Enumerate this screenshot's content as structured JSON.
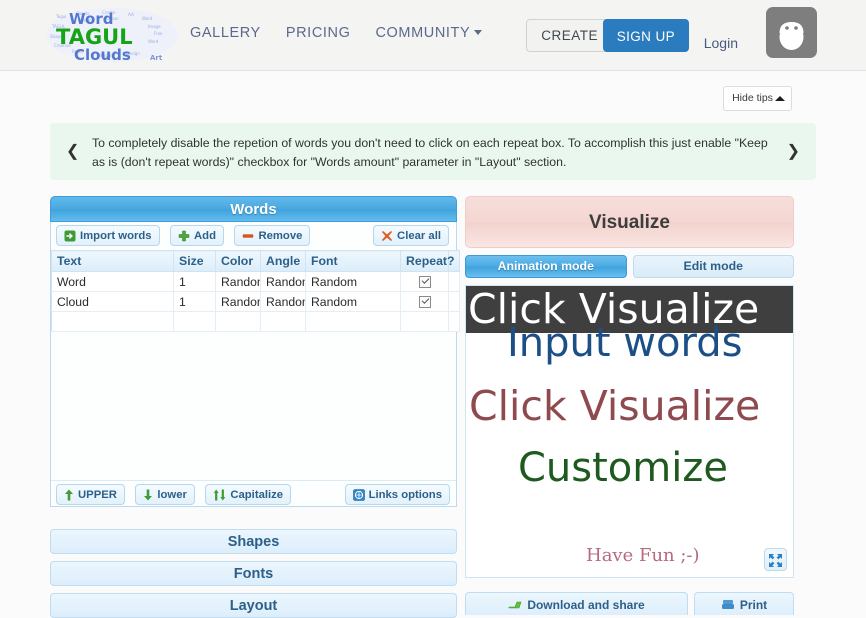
{
  "header": {
    "logo": {
      "name": "tagul-word-clouds-logo",
      "word_top": "Word",
      "word_mid": "TAGUL",
      "word_bottom": "Clouds"
    },
    "nav": [
      {
        "label": "GALLERY",
        "icon": "",
        "has_caret": false
      },
      {
        "label": "PRICING",
        "icon": "",
        "has_caret": false
      },
      {
        "label": "COMMUNITY",
        "icon": "chevron-down-icon",
        "has_caret": true
      }
    ],
    "create_label": "CREATE",
    "signup_label": "SIGN UP",
    "login_label": "Login",
    "avatar_icon": "owl-avatar-icon",
    "colors": {
      "signup_bg": "#2b7cbf",
      "nav_text": "#5b6a8c",
      "header_bg": "#f4f4f2",
      "avatar_bg": "#7e7e7e"
    }
  },
  "tips": {
    "hide_label": "Hide tips",
    "hide_icon": "chevron-up-icon",
    "prev_icon": "chevron-left-icon",
    "next_icon": "chevron-right-icon",
    "prev_glyph": "❮",
    "next_glyph": "❯",
    "text": "To completely disable the repetion of words you don't need to click on each repeat box. To accomplish this just enable \"Keep as is (don't repeat words)\" checkbox for \"Words amount\" parameter in \"Layout\" section.",
    "bg": "#e9f7ef"
  },
  "words_panel": {
    "title": "Words",
    "toolbar": [
      {
        "label": "Import words",
        "icon": "import-icon"
      },
      {
        "label": "Add",
        "icon": "plus-icon"
      },
      {
        "label": "Remove",
        "icon": "minus-icon"
      }
    ],
    "clear_all": {
      "label": "Clear all",
      "icon": "x-icon"
    },
    "table": {
      "columns": [
        "Text",
        "Size",
        "Color",
        "Angle",
        "Font",
        "Repeat?"
      ],
      "rows": [
        {
          "text": "Word",
          "size": "1",
          "color": "Random",
          "angle": "Random",
          "font": "Random",
          "repeat": true
        },
        {
          "text": "Cloud",
          "size": "1",
          "color": "Random",
          "angle": "Random",
          "font": "Random",
          "repeat": true
        },
        {
          "text": "",
          "size": "",
          "color": "",
          "angle": "",
          "font": "",
          "repeat": null
        }
      ]
    },
    "footer": [
      {
        "label": "UPPER",
        "icon": "arrow-up-icon"
      },
      {
        "label": "lower",
        "icon": "arrow-down-icon"
      },
      {
        "label": "Capitalize",
        "icon": "arrow-up-down-icon"
      }
    ],
    "links_options": {
      "label": "Links options",
      "icon": "links-icon"
    }
  },
  "sections": [
    {
      "label": "Shapes"
    },
    {
      "label": "Fonts"
    },
    {
      "label": "Layout"
    }
  ],
  "visualize_panel": {
    "visualize_label": "Visualize",
    "visualize_bg": "#f4d6d2",
    "modes": [
      {
        "label": "Animation mode",
        "active": true
      },
      {
        "label": "Edit mode",
        "active": false
      }
    ],
    "canvas_words": [
      {
        "text": "Input words",
        "color": "#1b4f86"
      },
      {
        "text": "Click Visualize",
        "color": "#8e4a4e"
      },
      {
        "text": "Click Visualize",
        "color": "#ffffff",
        "highlight_bg": "#3f3f3f"
      },
      {
        "text": "Customize",
        "color": "#1e5a1e"
      },
      {
        "text": "Have Fun ;-)",
        "color": "#b56a7e"
      }
    ],
    "fullscreen_icon": "fullscreen-expand-icon",
    "bottom_actions": [
      {
        "label": "Download and share",
        "icon": "download-icon"
      },
      {
        "label": "Print",
        "icon": "print-icon"
      }
    ]
  }
}
